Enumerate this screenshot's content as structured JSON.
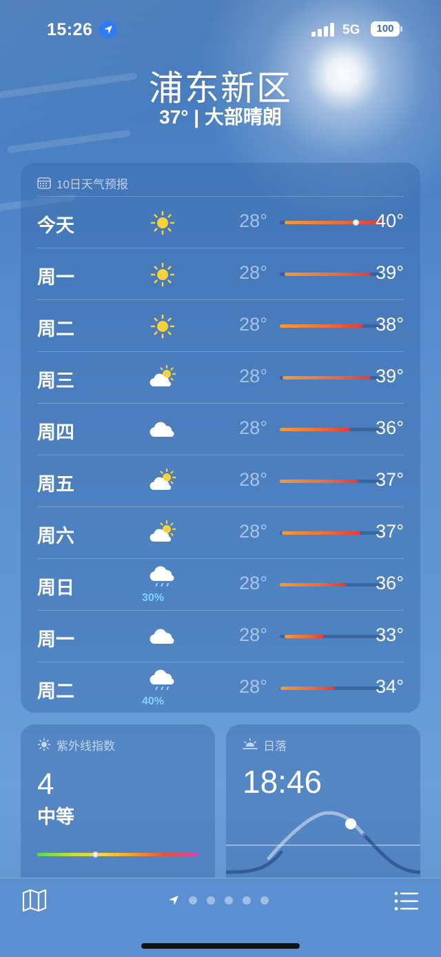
{
  "status_bar": {
    "time": "15:26",
    "network": "5G",
    "battery": "100"
  },
  "header": {
    "city": "浦东新区",
    "summary": "37° | 大部晴朗"
  },
  "forecast": {
    "title": "10日天气预报",
    "days": [
      {
        "day": "今天",
        "icon": "sun-icon",
        "low": "28°",
        "high": "40°",
        "precip": "",
        "bar": [
          0.05,
          1.0
        ],
        "current": 0.74
      },
      {
        "day": "周一",
        "icon": "sun-icon",
        "low": "28°",
        "high": "39°",
        "precip": "",
        "bar": [
          0.05,
          0.89
        ]
      },
      {
        "day": "周二",
        "icon": "sun-icon",
        "low": "28°",
        "high": "38°",
        "precip": "",
        "bar": [
          0.0,
          0.82
        ]
      },
      {
        "day": "周三",
        "icon": "partly-sunny-icon",
        "low": "28°",
        "high": "39°",
        "precip": "",
        "bar": [
          0.03,
          0.89
        ]
      },
      {
        "day": "周四",
        "icon": "cloud-icon",
        "low": "28°",
        "high": "36°",
        "precip": "",
        "bar": [
          0.0,
          0.69
        ]
      },
      {
        "day": "周五",
        "icon": "partly-sunny-icon",
        "low": "28°",
        "high": "37°",
        "precip": "",
        "bar": [
          0.0,
          0.77
        ]
      },
      {
        "day": "周六",
        "icon": "partly-sunny-icon",
        "low": "28°",
        "high": "37°",
        "precip": "",
        "bar": [
          0.02,
          0.79
        ]
      },
      {
        "day": "周日",
        "icon": "rain-cloud-icon",
        "low": "28°",
        "high": "36°",
        "precip": "30%",
        "bar": [
          0.0,
          0.65
        ]
      },
      {
        "day": "周一",
        "icon": "cloud-icon",
        "low": "28°",
        "high": "33°",
        "precip": "",
        "bar": [
          0.05,
          0.43
        ]
      },
      {
        "day": "周二",
        "icon": "rain-cloud-icon",
        "low": "28°",
        "high": "34°",
        "precip": "40%",
        "bar": [
          0.01,
          0.54
        ]
      }
    ]
  },
  "uv": {
    "title": "紫外线指数",
    "value": "4",
    "level": "中等",
    "position": 0.36
  },
  "sunset": {
    "title": "日落",
    "time": "18:46"
  },
  "pages": {
    "count": 5
  }
}
